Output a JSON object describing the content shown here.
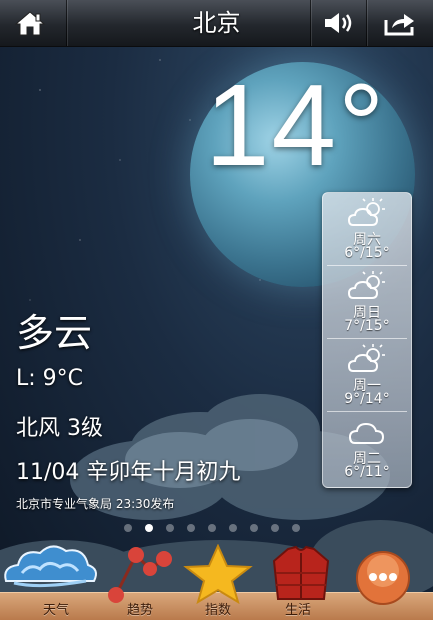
{
  "header": {
    "city": "北京",
    "icons": {
      "home": "home-icon",
      "sound": "speaker-icon",
      "share": "share-icon"
    }
  },
  "current": {
    "temperature": "14°",
    "condition": "多云",
    "low": "L: 9°C",
    "wind": "北风 3级",
    "date": "11/04 辛卯年十月初九",
    "source": "北京市专业气象局 23:30发布"
  },
  "forecast": [
    {
      "day": "周六",
      "range": "6°/15°",
      "icon": "partly-cloudy-icon"
    },
    {
      "day": "周日",
      "range": "7°/15°",
      "icon": "partly-cloudy-icon"
    },
    {
      "day": "周一",
      "range": "9°/14°",
      "icon": "partly-cloudy-icon"
    },
    {
      "day": "周二",
      "range": "6°/11°",
      "icon": "cloudy-icon"
    }
  ],
  "pager": {
    "count": 9,
    "active_index": 1
  },
  "dock": [
    {
      "label": "天气",
      "icon": "weather-cloud-icon"
    },
    {
      "label": "趋势",
      "icon": "trend-icon"
    },
    {
      "label": "指数",
      "icon": "star-icon"
    },
    {
      "label": "生活",
      "icon": "jacket-icon"
    },
    {
      "label": "",
      "icon": "more-icon"
    }
  ],
  "colors": {
    "dock_wood": "#c88a5a",
    "panel": "#d8dde3",
    "star": "#f5b81f",
    "jacket": "#b8241c"
  }
}
